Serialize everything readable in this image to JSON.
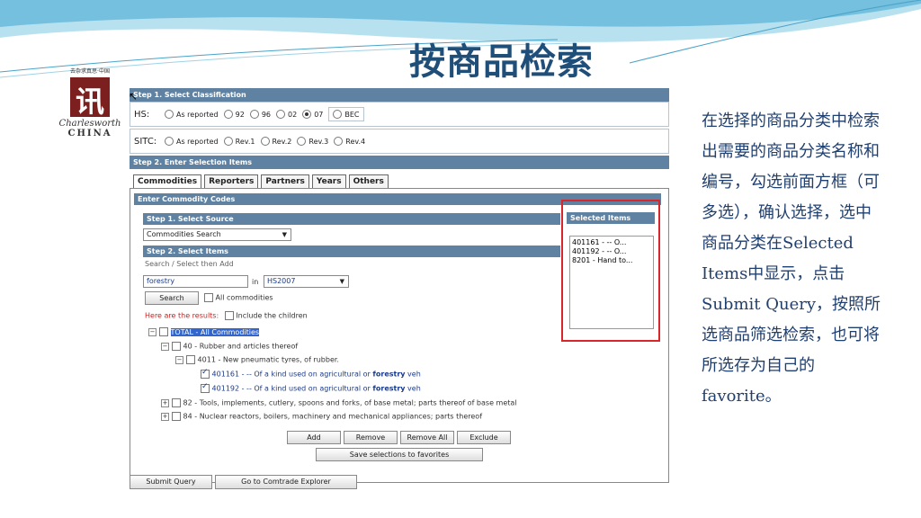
{
  "slide": {
    "title": "按商品检索",
    "description": "在选择的商品分类中检索出需要的商品分类名称和编号，勾选前面方框（可多选），确认选择，选中商品分类在Selected Items中显示，点击Submit Query，按照所选商品筛选检索，也可将所选存为自己的favorite。"
  },
  "logo": {
    "motto": "去杂求真思·中国",
    "glyph": "讯",
    "brand": "Charlesworth",
    "brand_sub": "CHINA"
  },
  "step1": {
    "title": "Step 1. Select Classification",
    "hs_label": "HS:",
    "hs_options": [
      "As reported",
      "92",
      "96",
      "02",
      "07"
    ],
    "hs_selected": "07",
    "bec_label": "BEC",
    "sitc_label": "SITC:",
    "sitc_options": [
      "As reported",
      "Rev.1",
      "Rev.2",
      "Rev.3",
      "Rev.4"
    ]
  },
  "step2": {
    "title": "Step 2. Enter Selection Items",
    "tabs": [
      "Commodities",
      "Reporters",
      "Partners",
      "Years",
      "Others"
    ],
    "active_tab": "Commodities"
  },
  "commodity": {
    "header": "Enter Commodity Codes",
    "source_title": "Step 1. Select Source",
    "source_value": "Commodities Search",
    "items_title": "Step 2. Select Items",
    "hint": "Search / Select then Add",
    "search_value": "forestry",
    "in_label": "in",
    "class_value": "HS2007",
    "search_button": "Search",
    "all_commodities": "All commodities",
    "results_label": "Here are the results:",
    "include_children": "Include the children",
    "selected_title": "Selected Items",
    "selected_items": [
      "401161 - -- O...",
      "401192 - -- O...",
      "8201 - Hand to..."
    ],
    "tree": [
      {
        "text": "TOTAL - All Commodities",
        "checked": false
      },
      {
        "text": "40 - Rubber and articles thereof",
        "checked": false
      },
      {
        "text": "4011 - New pneumatic tyres, of rubber.",
        "checked": false
      },
      {
        "text": "401161 - -- Of a kind used on agricultural or",
        "bold": "forestry",
        "tail": "veh",
        "checked": true
      },
      {
        "text": "401192 - -- Of a kind used on agricultural or",
        "bold": "forestry",
        "tail": "veh",
        "checked": true
      },
      {
        "text": "82 - Tools, implements, cutlery, spoons and forks, of base metal; parts thereof of base metal",
        "checked": false
      },
      {
        "text": "84 - Nuclear reactors, boilers, machinery and mechanical appliances; parts thereof",
        "checked": false
      }
    ],
    "buttons": {
      "add": "Add",
      "remove": "Remove",
      "remove_all": "Remove All",
      "exclude": "Exclude",
      "save": "Save selections to favorites"
    }
  },
  "footer": {
    "submit": "Submit Query",
    "explorer": "Go to Comtrade Explorer"
  },
  "colors": {
    "bar": "#5f82a2",
    "title": "#1f4e79",
    "highlight_box": "#d9262b"
  }
}
